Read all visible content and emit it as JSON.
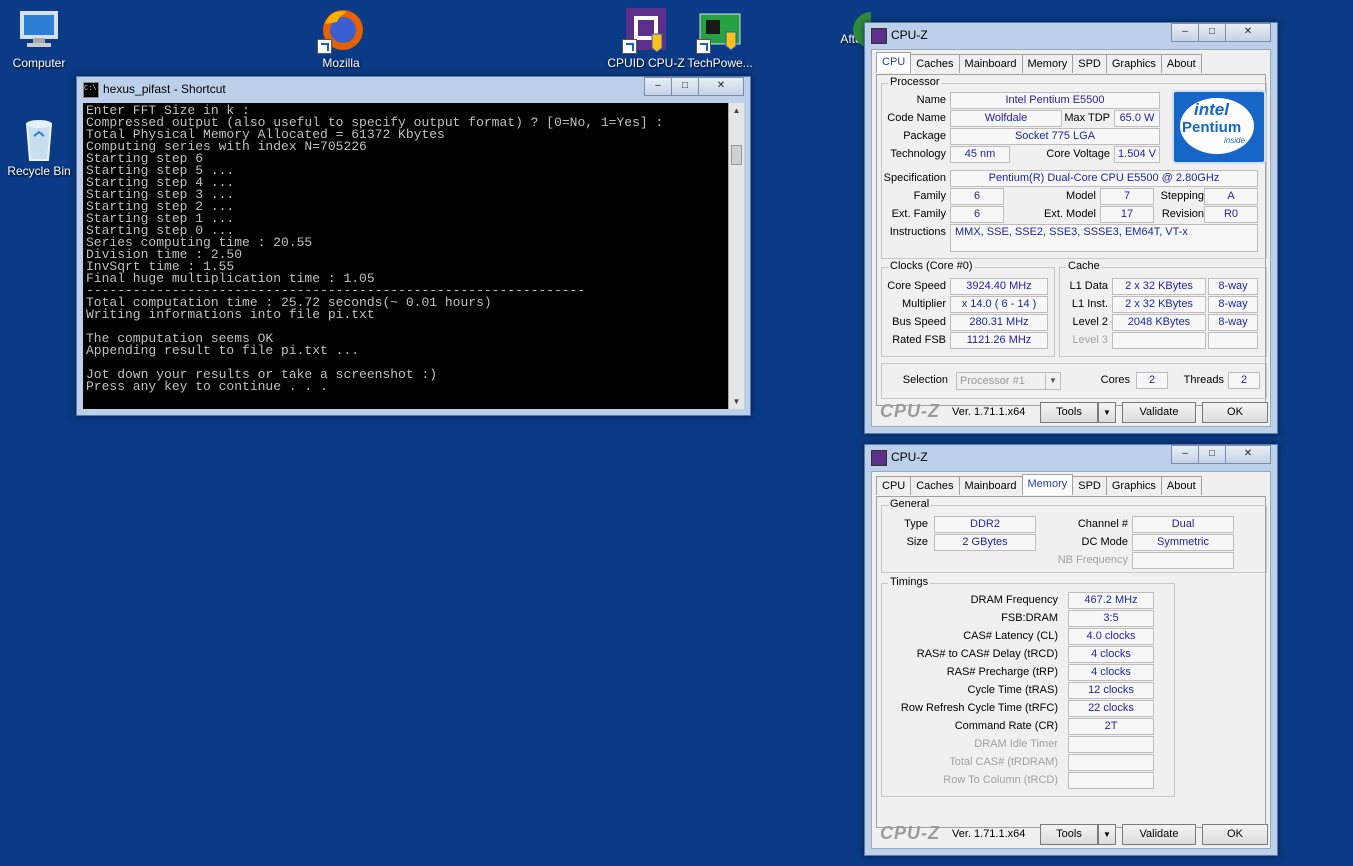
{
  "desktop": {
    "icons": [
      {
        "label": "Computer"
      },
      {
        "label": "Recycle Bin"
      },
      {
        "label": "Mozilla"
      },
      {
        "label": "CPUID CPU-Z"
      },
      {
        "label": "TechPowe..."
      },
      {
        "label": "Afte"
      }
    ]
  },
  "console": {
    "title": "hexus_pifast - Shortcut",
    "lines": [
      "Enter FFT Size in k :",
      "Compressed output (also useful to specify output format) ? [0=No, 1=Yes] :",
      "Total Physical Memory Allocated = 61372 Kbytes",
      "Computing series with index N=705226",
      "Starting step 6",
      "Starting step 5 ...",
      "Starting step 4 ...",
      "Starting step 3 ...",
      "Starting step 2 ...",
      "Starting step 1 ...",
      "Starting step 0 ...",
      "Series computing time : 20.55",
      "Division time : 2.50",
      "InvSqrt time : 1.55",
      "Final huge multiplication time : 1.05",
      "----------------------------------------------------------------",
      "Total computation time : 25.72 seconds(~ 0.01 hours)",
      "Writing informations into file pi.txt",
      "",
      "The computation seems OK",
      "Appending result to file pi.txt ...",
      "",
      "Jot down your results or take a screenshot :)",
      "Press any key to continue . . ."
    ]
  },
  "tabs": [
    "CPU",
    "Caches",
    "Mainboard",
    "Memory",
    "SPD",
    "Graphics",
    "About"
  ],
  "cpuz_cpu": {
    "title": "CPU-Z",
    "active_tab": "CPU",
    "processor_group": "Processor",
    "name_label": "Name",
    "name": "Intel Pentium E5500",
    "codename_label": "Code Name",
    "codename": "Wolfdale",
    "tdp_label": "Max TDP",
    "tdp": "65.0 W",
    "package_label": "Package",
    "package": "Socket 775 LGA",
    "technology_label": "Technology",
    "technology": "45 nm",
    "voltage_label": "Core Voltage",
    "voltage": "1.504 V",
    "spec_label": "Specification",
    "spec": "Pentium(R) Dual-Core  CPU     E5500  @ 2.80GHz",
    "family_label": "Family",
    "family": "6",
    "model_label": "Model",
    "model": "7",
    "stepping_label": "Stepping",
    "stepping": "A",
    "extfamily_label": "Ext. Family",
    "extfamily": "6",
    "extmodel_label": "Ext. Model",
    "extmodel": "17",
    "revision_label": "Revision",
    "revision": "R0",
    "instructions_label": "Instructions",
    "instructions": "MMX, SSE, SSE2, SSE3, SSSE3, EM64T, VT-x",
    "logo": {
      "brand": "intel",
      "product": "Pentium",
      "tag": "inside"
    },
    "clocks_group": "Clocks (Core #0)",
    "corespeed_label": "Core Speed",
    "corespeed": "3924.40 MHz",
    "multiplier_label": "Multiplier",
    "multiplier": "x 14.0 ( 6 - 14 )",
    "busspeed_label": "Bus Speed",
    "busspeed": "280.31 MHz",
    "ratedfsb_label": "Rated FSB",
    "ratedfsb": "1121.26 MHz",
    "cache_group": "Cache",
    "l1d_label": "L1 Data",
    "l1d": "2 x 32 KBytes",
    "l1d_way": "8-way",
    "l1i_label": "L1 Inst.",
    "l1i": "2 x 32 KBytes",
    "l1i_way": "8-way",
    "l2_label": "Level 2",
    "l2": "2048 KBytes",
    "l2_way": "8-way",
    "l3_label": "Level 3",
    "selection_label": "Selection",
    "selection": "Processor #1",
    "cores_label": "Cores",
    "cores": "2",
    "threads_label": "Threads",
    "threads": "2"
  },
  "cpuz_mem": {
    "title": "CPU-Z",
    "active_tab": "Memory",
    "general_group": "General",
    "type_label": "Type",
    "type": "DDR2",
    "size_label": "Size",
    "size": "2 GBytes",
    "channel_label": "Channel #",
    "channel": "Dual",
    "dcmode_label": "DC Mode",
    "dcmode": "Symmetric",
    "nbfreq_label": "NB Frequency",
    "timings_group": "Timings",
    "timings": [
      {
        "label": "DRAM Frequency",
        "value": "467.2 MHz",
        "dim": false
      },
      {
        "label": "FSB:DRAM",
        "value": "3:5",
        "dim": false
      },
      {
        "label": "CAS# Latency (CL)",
        "value": "4.0 clocks",
        "dim": false
      },
      {
        "label": "RAS# to CAS# Delay (tRCD)",
        "value": "4 clocks",
        "dim": false
      },
      {
        "label": "RAS# Precharge (tRP)",
        "value": "4 clocks",
        "dim": false
      },
      {
        "label": "Cycle Time (tRAS)",
        "value": "12 clocks",
        "dim": false
      },
      {
        "label": "Row Refresh Cycle Time (tRFC)",
        "value": "22 clocks",
        "dim": false
      },
      {
        "label": "Command Rate (CR)",
        "value": "2T",
        "dim": false
      },
      {
        "label": "DRAM Idle Timer",
        "value": "",
        "dim": true
      },
      {
        "label": "Total CAS# (tRDRAM)",
        "value": "",
        "dim": true
      },
      {
        "label": "Row To Column (tRCD)",
        "value": "",
        "dim": true
      }
    ]
  },
  "footer": {
    "logo": "CPU-Z",
    "version": "Ver. 1.71.1.x64",
    "tools": "Tools",
    "validate": "Validate",
    "ok": "OK"
  },
  "colors": {
    "desktop_bg": "#0b3a86",
    "value_text": "#1f1fa0",
    "active_tab": "#1f3fb0"
  }
}
